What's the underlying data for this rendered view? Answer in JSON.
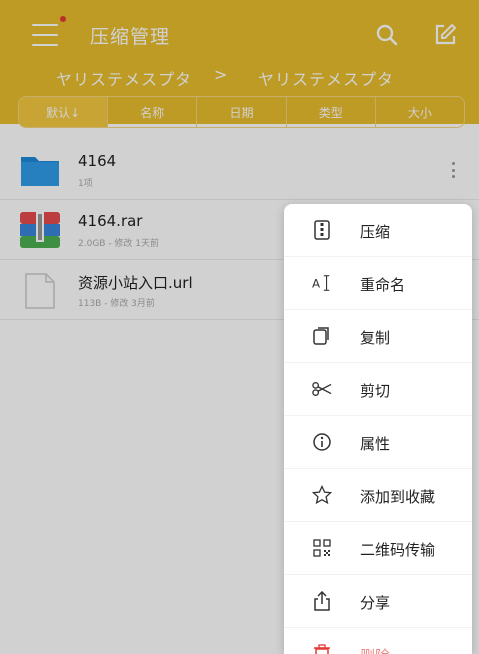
{
  "app": {
    "title": "压缩管理"
  },
  "breadcrumb": [
    "ヤリステメスプタ",
    ">",
    "ヤリステメスプタ"
  ],
  "sort_tabs": [
    {
      "label": "默认↓",
      "active": true
    },
    {
      "label": "名称",
      "active": false
    },
    {
      "label": "日期",
      "active": false
    },
    {
      "label": "类型",
      "active": false
    },
    {
      "label": "大小",
      "active": false
    }
  ],
  "files": [
    {
      "name": "4164",
      "meta": "1项",
      "icon": "folder-icon"
    },
    {
      "name": "4164.rar",
      "meta": "2.0GB - 修改 1天前",
      "icon": "rar-archive-icon"
    },
    {
      "name": "资源小站入口.url",
      "meta": "113B - 修改 3月前",
      "icon": "document-icon"
    }
  ],
  "context_menu": [
    {
      "label": "压缩",
      "icon": "compress-icon"
    },
    {
      "label": "重命名",
      "icon": "rename-icon"
    },
    {
      "label": "复制",
      "icon": "copy-icon"
    },
    {
      "label": "剪切",
      "icon": "scissors-icon"
    },
    {
      "label": "属性",
      "icon": "info-icon"
    },
    {
      "label": "添加到收藏",
      "icon": "star-icon"
    },
    {
      "label": "二维码传输",
      "icon": "qr-code-icon"
    },
    {
      "label": "分享",
      "icon": "share-icon"
    },
    {
      "label": "删除",
      "icon": "delete-icon"
    }
  ],
  "colors": {
    "accent": "#e8bd2e",
    "notify_dot": "#e53935"
  }
}
